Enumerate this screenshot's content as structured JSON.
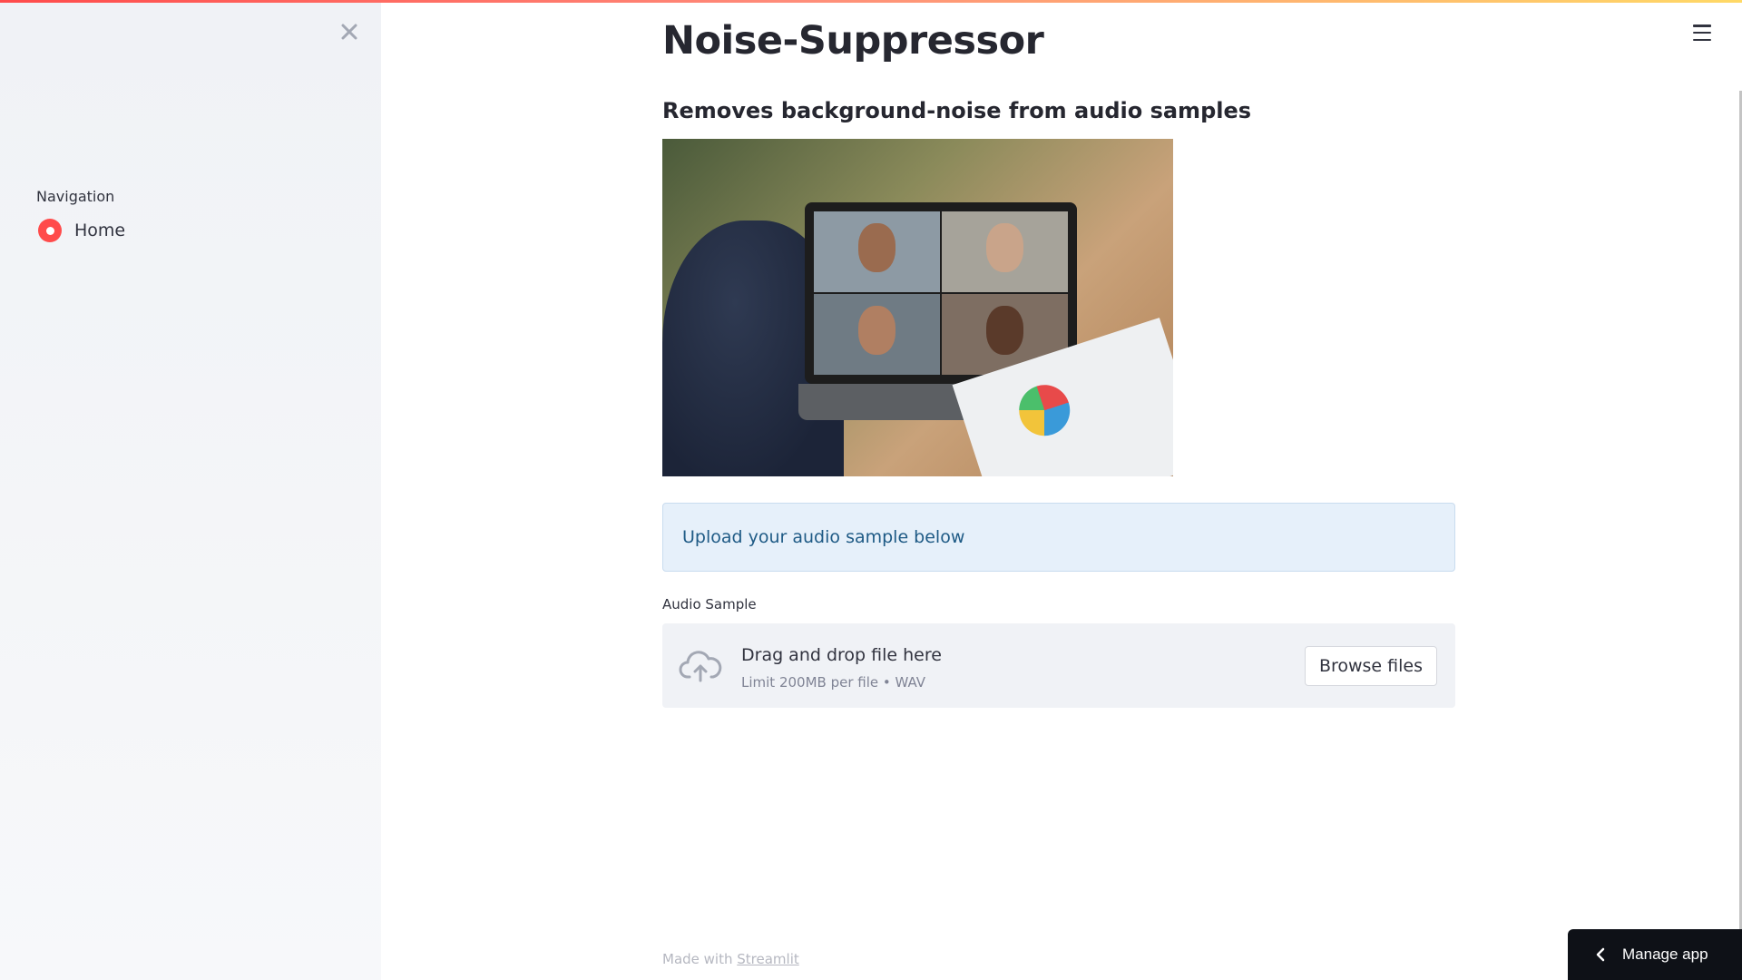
{
  "sidebar": {
    "navigation_label": "Navigation",
    "items": [
      {
        "label": "Home",
        "selected": true
      }
    ]
  },
  "main": {
    "title": "Noise-Suppressor",
    "subtitle": "Removes background-noise from audio samples",
    "info_message": "Upload your audio sample below",
    "uploader": {
      "label": "Audio Sample",
      "drop_text": "Drag and drop file here",
      "limit_text": "Limit 200MB per file • WAV",
      "browse_label": "Browse files"
    }
  },
  "footer": {
    "made_with": "Made with",
    "link_text": "Streamlit"
  },
  "manage_app": {
    "label": "Manage app"
  },
  "colors": {
    "accent": "#ff4b4b",
    "info_bg": "#e6f0fa",
    "info_text": "#1e5a85",
    "sidebar_bg": "#f0f2f6"
  }
}
